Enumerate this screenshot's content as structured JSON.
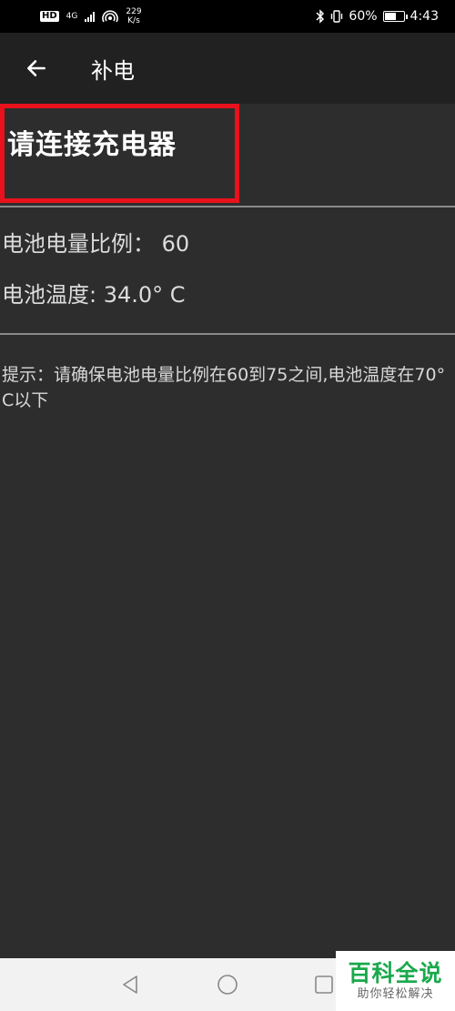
{
  "status_bar": {
    "hd": "HD",
    "network": "4G",
    "speed_value": "229",
    "speed_unit": "K/s",
    "battery_percent": "60%",
    "battery_level": 0.6,
    "time": "4:43"
  },
  "app_bar": {
    "back_icon": "arrow-left-icon",
    "title": "补电"
  },
  "content": {
    "charger_prompt": "请连接充电器",
    "battery_level_text": "电池电量比例： 60",
    "battery_temp_text": "电池温度: 34.0° C",
    "hint_text": "提示：请确保电池电量比例在60到75之间,电池温度在70° C以下"
  },
  "colors": {
    "highlight_border": "#e8121c",
    "background": "#2d2d2d",
    "app_bar": "#212121"
  },
  "nav_bar": {
    "back_icon": "triangle-back-icon",
    "home_icon": "circle-home-icon",
    "recents_icon": "square-recents-icon"
  },
  "watermark": {
    "main": "百科全说",
    "sub": "助你轻松解决"
  }
}
